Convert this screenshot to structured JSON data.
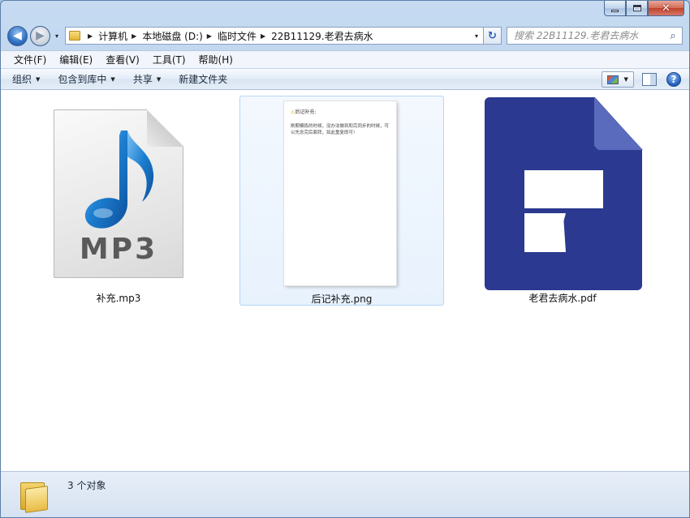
{
  "window": {
    "caption_buttons": [
      "minimize-icon",
      "maximize-icon",
      "close-icon"
    ],
    "close_glyph": "✕"
  },
  "nav": {
    "back_glyph": "◀",
    "forward_glyph": "▶",
    "dropdown_glyph": "▾",
    "breadcrumbs": [
      "计算机",
      "本地磁盘 (D:)",
      "临时文件",
      "22B11129.老君去病水"
    ],
    "refresh_glyph": "↻",
    "search_placeholder": "搜索 22B11129.老君去病水",
    "search_icon": "⌕"
  },
  "menu": [
    "文件(F)",
    "编辑(E)",
    "查看(V)",
    "工具(T)",
    "帮助(H)"
  ],
  "toolbar": {
    "organize": "组织",
    "include_in_library": "包含到库中",
    "share": "共享",
    "new_folder": "新建文件夹",
    "help_glyph": "?"
  },
  "files": [
    {
      "name": "补充.mp3",
      "icon": "mp3-file-icon",
      "badge": "MP3",
      "selected": false
    },
    {
      "name": "后记补充.png",
      "icon": "png-thumbnail",
      "selected": true,
      "thumb_title": "后记补充:",
      "thumb_body": "刷期模拣的时候，没办法做到和完同步的时候，可以先念完后面拜，如此重复即可!"
    },
    {
      "name": "老君去病水.pdf",
      "icon": "pdf-file-icon",
      "selected": false
    }
  ],
  "status": {
    "count_text": "3 个对象"
  },
  "colors": {
    "pdf_blue": "#2b3990",
    "mp3_note_blue": "#1d7fd1",
    "selection_border": "#b7d6f6"
  }
}
